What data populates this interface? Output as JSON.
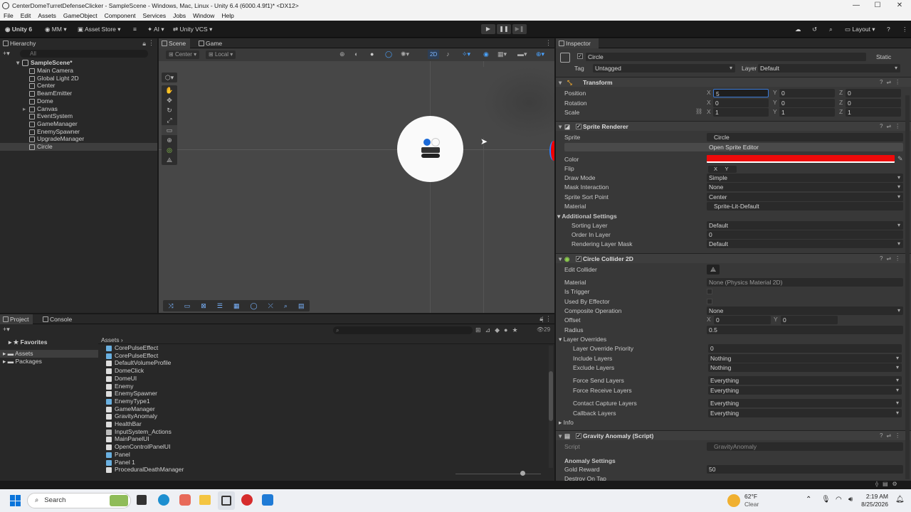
{
  "window": {
    "title": "CenterDomeTurretDefenseClicker - SampleScene - Windows, Mac, Linux - Unity 6.4 (6000.4.9f1)* <DX12>",
    "menu": [
      "File",
      "Edit",
      "Assets",
      "GameObject",
      "Component",
      "Services",
      "Jobs",
      "Window",
      "Help"
    ]
  },
  "toolbar": {
    "unity": "Unity 6",
    "account": "MM",
    "asset_store": "Asset Store",
    "ai": "AI",
    "vcs": "Unity VCS",
    "layout": "Layout"
  },
  "hierarchy": {
    "tab": "Hierarchy",
    "search_placeholder": "All",
    "scene": "SampleScene*",
    "items": [
      "Main Camera",
      "Global Light 2D",
      "Center",
      "BeamEmitter",
      "Dome",
      "Canvas",
      "EventSystem",
      "GameManager",
      "EnemySpawner",
      "UpgradeManager",
      "Circle"
    ],
    "selected": "Circle"
  },
  "scene": {
    "tabs": [
      "Scene",
      "Game"
    ],
    "pivot": "Center",
    "space": "Local",
    "mode2d": "2D"
  },
  "inspector": {
    "tab": "Inspector",
    "object_name": "Circle",
    "static_label": "Static",
    "tag_label": "Tag",
    "tag": "Untagged",
    "layer_label": "Layer",
    "layer": "Default",
    "transform": {
      "title": "Transform",
      "position_label": "Position",
      "position": [
        "5",
        "0",
        "0"
      ],
      "rotation_label": "Rotation",
      "rotation": [
        "0",
        "0",
        "0"
      ],
      "scale_label": "Scale",
      "scale": [
        "1",
        "1",
        "1"
      ]
    },
    "sprite_renderer": {
      "title": "Sprite Renderer",
      "sprite_label": "Sprite",
      "sprite": "Circle",
      "open_editor": "Open Sprite Editor",
      "color_label": "Color",
      "color": "#ee0a0a",
      "flip_label": "Flip",
      "flip_x": "X",
      "flip_y": "Y",
      "draw_mode_label": "Draw Mode",
      "draw_mode": "Simple",
      "mask_label": "Mask Interaction",
      "mask": "None",
      "sort_point_label": "Sprite Sort Point",
      "sort_point": "Center",
      "material_label": "Material",
      "material": "Sprite-Lit-Default",
      "additional": "Additional Settings",
      "sorting_layer_label": "Sorting Layer",
      "sorting_layer": "Default",
      "order_label": "Order In Layer",
      "order": "0",
      "rlm_label": "Rendering Layer Mask",
      "rlm": "Default"
    },
    "circle_collider": {
      "title": "Circle Collider 2D",
      "edit_label": "Edit Collider",
      "material_label": "Material",
      "material": "None (Physics Material 2D)",
      "trigger_label": "Is Trigger",
      "effector_label": "Used By Effector",
      "composite_label": "Composite Operation",
      "composite": "None",
      "offset_label": "Offset",
      "offset": [
        "0",
        "0"
      ],
      "radius_label": "Radius",
      "radius": "0.5",
      "layer_overrides": "Layer Overrides",
      "priority_label": "Layer Override Priority",
      "priority": "0",
      "include_label": "Include Layers",
      "include": "Nothing",
      "exclude_label": "Exclude Layers",
      "exclude": "Nothing",
      "send_label": "Force Send Layers",
      "send": "Everything",
      "receive_label": "Force Receive Layers",
      "receive": "Everything",
      "contact_label": "Contact Capture Layers",
      "contact": "Everything",
      "callback_label": "Callback Layers",
      "callback": "Everything",
      "info": "Info"
    },
    "gravity": {
      "title": "Gravity Anomaly (Script)",
      "script_label": "Script",
      "script": "GravityAnomaly",
      "settings": "Anomaly Settings",
      "gold_label": "Gold Reward",
      "gold": "50",
      "destroy_label": "Destroy On Tap"
    }
  },
  "project": {
    "tabs": [
      "Project",
      "Console"
    ],
    "favorites": "Favorites",
    "assets": "Assets",
    "packages": "Packages",
    "breadcrumb": "Assets",
    "count": "29",
    "files": [
      "CorePulseEffect",
      "CorePulseEffect",
      "DefaultVolumeProfile",
      "DomeClick",
      "DomeUI",
      "Enemy",
      "EnemySpawner",
      "EnemyType1",
      "GameManager",
      "GravityAnomaly",
      "HealthBar",
      "InputSystem_Actions",
      "MainPanelUI",
      "OpenControlPanelUI",
      "Panel",
      "Panel 1",
      "ProceduralDeathManager"
    ]
  },
  "taskbar": {
    "search": "Search",
    "weather_temp": "62°F",
    "weather_desc": "Clear",
    "time": "2:19 AM",
    "date": "8/25/2026"
  }
}
